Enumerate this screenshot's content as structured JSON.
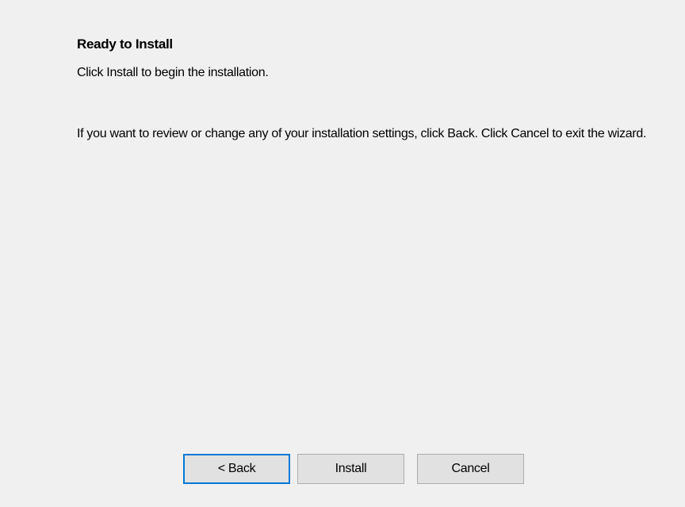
{
  "page": {
    "title": "Ready to Install",
    "subtitle": "Click Install to begin the installation.",
    "body": "If you want to review or change any of your installation settings, click Back. Click Cancel to exit the wizard."
  },
  "buttons": {
    "back_label": "< Back",
    "install_label": "Install",
    "cancel_label": "Cancel"
  },
  "colors": {
    "background": "#f0f0f0",
    "button_face": "#e1e1e1",
    "button_border": "#adadad",
    "focus_border": "#0078d7"
  }
}
